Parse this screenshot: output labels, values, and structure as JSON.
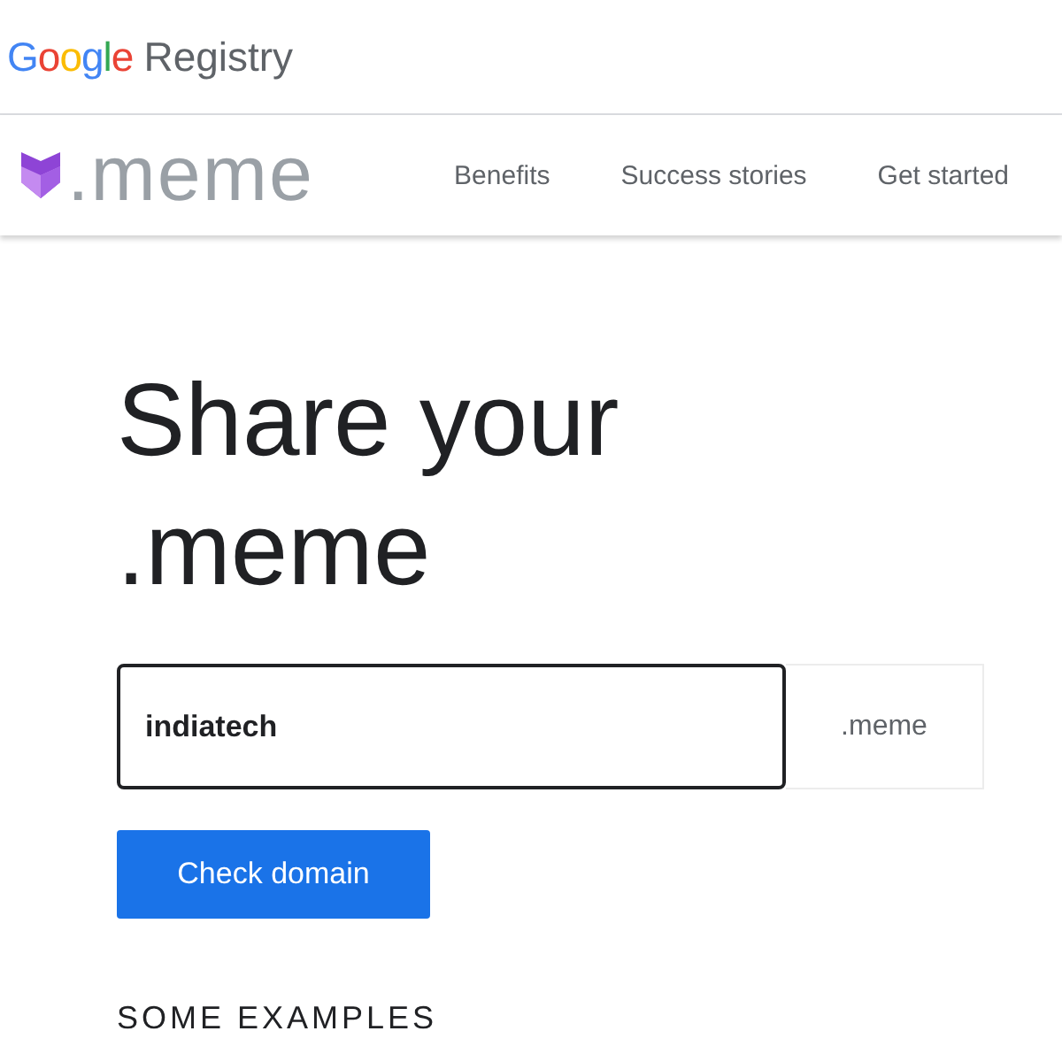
{
  "header": {
    "logo": "Google",
    "product": "Registry"
  },
  "nav": {
    "brand": ".meme",
    "links": [
      {
        "label": "Benefits"
      },
      {
        "label": "Success stories"
      },
      {
        "label": "Get started"
      }
    ]
  },
  "hero": {
    "title_lines": [
      "Share your",
      ".meme"
    ],
    "domain_field": {
      "value": "indiatech",
      "suffix": ".meme"
    },
    "button": "Check domain",
    "examples_heading": "SOME EXAMPLES"
  }
}
